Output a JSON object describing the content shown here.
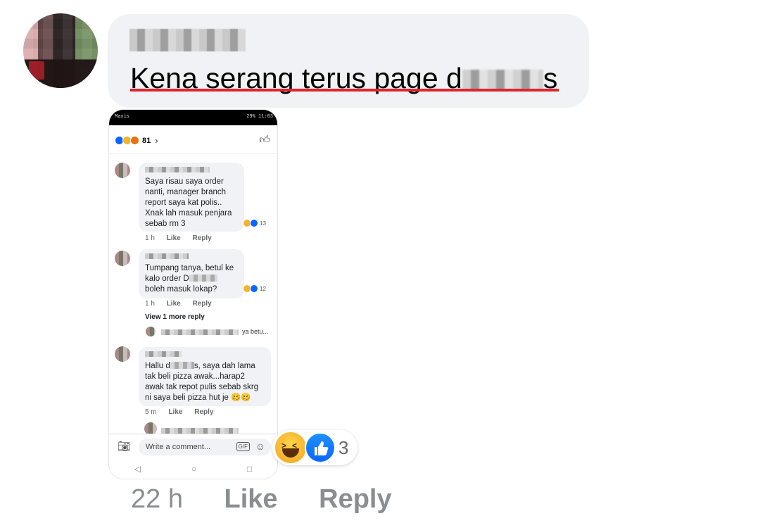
{
  "comment": {
    "author": "",
    "text_before": "Kena serang terus page d",
    "text_after": "s",
    "time": "22 h",
    "like_label": "Like",
    "reply_label": "Reply",
    "reaction_count": "3",
    "reactions": [
      "haha",
      "like"
    ]
  },
  "embedded_screenshot": {
    "status_left": "Maxis",
    "status_right": "29%  11:03",
    "reaction_total": "81",
    "comments": [
      {
        "text": "Saya risau saya order nanti, manager branch report saya kat polis.. Xnak lah masuk penjara sebab rm 3",
        "reactions": "13",
        "time": "1 h",
        "like": "Like",
        "reply": "Reply"
      },
      {
        "text_before": "Tumpang tanya, betul ke kalo order D",
        "text_after": " boleh masuk lokap?",
        "reactions": "12",
        "time": "1 h",
        "like": "Like",
        "reply": "Reply"
      },
      {
        "view_more": "View 1 more reply",
        "reply_preview": "ya betu..."
      },
      {
        "text_before": "Hallu d",
        "text_after": "s, saya dah lama tak beli pizza awak...harap2 awak tak repot pulis sebab skrg ni saya beli pizza hut je 🥴🥴",
        "time": "5 m",
        "like": "Like",
        "reply": "Reply"
      }
    ],
    "composer_placeholder": "Write a comment...",
    "gif_label": "GIF",
    "nav": [
      "◁",
      "○",
      "□"
    ]
  },
  "icons": {
    "like": "thumbs-up-icon",
    "haha": "haha-emoji-icon",
    "camera": "camera-icon",
    "smile": "smile-icon"
  },
  "colors": {
    "bubble": "#f0f2f5",
    "like_blue": "#0866ff",
    "underline_red": "#e0242c",
    "meta_gray": "#65676b"
  }
}
